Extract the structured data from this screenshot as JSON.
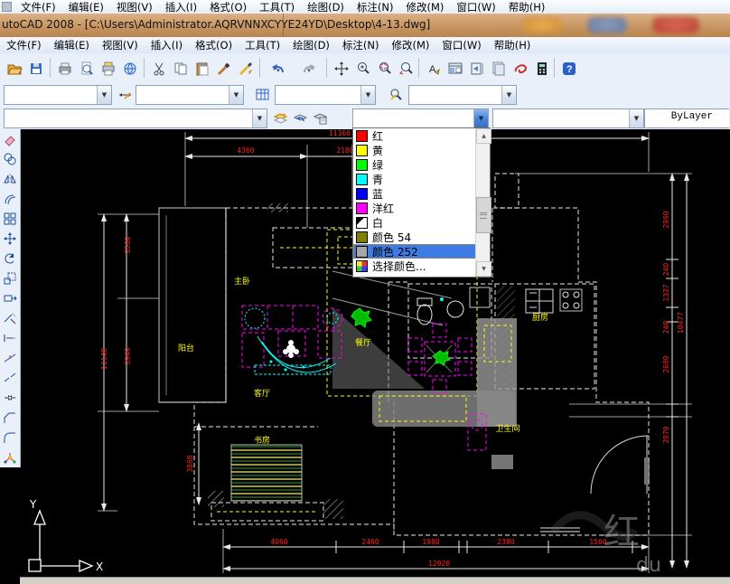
{
  "window": {
    "title": "utoCAD 2008 - [C:\\Users\\Administrator.AQRVNNXCYYE24YD\\Desktop\\4-13.dwg]"
  },
  "menu": {
    "items": [
      "文件(F)",
      "编辑(E)",
      "视图(V)",
      "插入(I)",
      "格式(O)",
      "工具(T)",
      "绘图(D)",
      "标注(N)",
      "修改(M)",
      "窗口(W)",
      "帮助(H)"
    ]
  },
  "toolbars": {
    "standard_icons": [
      "open",
      "save",
      "print",
      "print-preview",
      "plot",
      "publish",
      "cut",
      "copy",
      "paste",
      "match-properties",
      "block-editor",
      "undo",
      "redo",
      "pan",
      "zoom-realtime",
      "zoom-window",
      "zoom-previous",
      "find",
      "designcenter",
      "tool-palettes",
      "sheet-set-manager",
      "markup-set-manager",
      "quick-calc",
      "help"
    ],
    "styles_icons": [
      "dim-style",
      "table-style",
      "quick-select"
    ],
    "layer_icons": [
      "make-object-layer-current",
      "layer-previous",
      "layer-properties"
    ],
    "modify_icons": [
      "erase",
      "copy",
      "mirror",
      "offset",
      "array",
      "move",
      "rotate",
      "scale",
      "stretch",
      "trim",
      "extend",
      "break-at-point",
      "break",
      "join",
      "chamfer",
      "fillet",
      "explode"
    ]
  },
  "properties_bar": {
    "color_value": "",
    "linetype_value": "",
    "lineweight_value": "ByLayer"
  },
  "color_dropdown": {
    "items": [
      {
        "label": "红",
        "swatch": "#FF0000"
      },
      {
        "label": "黄",
        "swatch": "#FFFF00"
      },
      {
        "label": "绿",
        "swatch": "#00FF00"
      },
      {
        "label": "青",
        "swatch": "#00FFFF"
      },
      {
        "label": "蓝",
        "swatch": "#0000FF"
      },
      {
        "label": "洋红",
        "swatch": "#FF00FF"
      },
      {
        "label": "白",
        "swatch": "#FFFFFF"
      },
      {
        "label": "颜色 54",
        "swatch": "#7F7F00"
      },
      {
        "label": "颜色 252",
        "swatch": "#A6A6A6",
        "selected": true
      },
      {
        "label": "选择颜色...",
        "swatch": "multi"
      }
    ],
    "selected_label": "颜色 252"
  },
  "drawing": {
    "dims": {
      "top_total": "11160",
      "top_1": "4360",
      "top_2": "2180",
      "left_total": "11140",
      "left_1": "3560",
      "left_2": "3940",
      "left_inner": "3060",
      "right_total": "10477",
      "right_1": "2960",
      "right_2": "240",
      "right_3": "1327",
      "right_4": "240",
      "right_5": "2600",
      "right_6": "2070",
      "bottom_1": "4060",
      "bottom_2": "2460",
      "bottom_3": "1980",
      "bottom_4": "2380",
      "bottom_5": "1560",
      "bottom_total": "12920"
    },
    "room_labels": {
      "balcony": "阳台",
      "master_bedroom": "主卧",
      "living_room": "客厅",
      "dining_room": "餐厅",
      "kitchen": "厨房",
      "bathroom": "卫生间",
      "study": "书房"
    },
    "ucs": {
      "x": "X",
      "y": "Y"
    },
    "watermark": {
      "glyph": "红",
      "text": "du"
    }
  },
  "colors": {
    "dim_text": "#FF2020",
    "label_text": "#FFFF00",
    "wall": "#BDBDBD",
    "sofa": "#FF00FF",
    "bed_furniture": "#FFFF00",
    "rug": "#00FFFF",
    "plant": "#00DD00",
    "selection_bg": "#3D7BE5",
    "title_bar": "#C69460"
  }
}
